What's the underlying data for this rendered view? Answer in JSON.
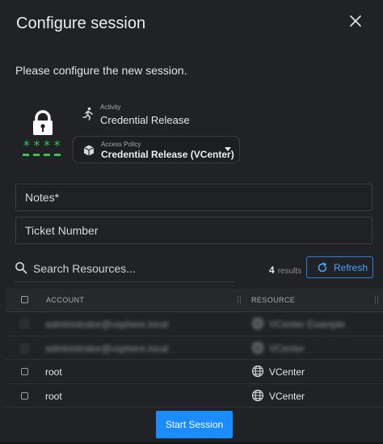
{
  "dialog": {
    "title": "Configure session",
    "subtitle": "Please configure the new session."
  },
  "lock": {
    "masked": "****"
  },
  "activity": {
    "label": "Activity",
    "value": "Credential Release",
    "icon": "running-person-icon"
  },
  "access_policy": {
    "label": "Access Policy",
    "value": "Credential Release (VCenter)",
    "icon": "cube-icon"
  },
  "fields": {
    "notes_placeholder": "Notes*",
    "ticket_placeholder": "Ticket Number"
  },
  "search": {
    "placeholder": "Search Resources..."
  },
  "results": {
    "count": "4",
    "word": "results"
  },
  "refresh": {
    "label": "Refresh"
  },
  "table": {
    "columns": [
      "ACCOUNT",
      "RESOURCE"
    ],
    "rows": [
      {
        "account": "administrator@vsphere.local",
        "resource": "VCenter Example",
        "redacted": true
      },
      {
        "account": "administrator@vsphere.local",
        "resource": "VCenter",
        "redacted": true
      },
      {
        "account": "root",
        "resource": "VCenter",
        "redacted": false
      },
      {
        "account": "root",
        "resource": "VCenter",
        "redacted": false
      }
    ]
  },
  "actions": {
    "start_session": "Start Session"
  },
  "colors": {
    "accent": "#1a8cff",
    "password_green": "#35c456",
    "background": "#202226"
  }
}
